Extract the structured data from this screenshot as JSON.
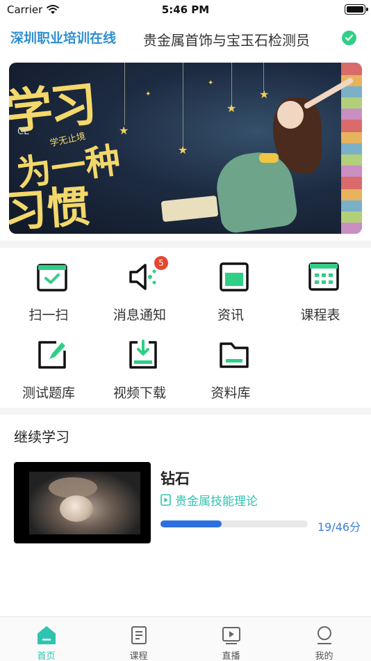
{
  "status_bar": {
    "carrier": "Carrier",
    "time": "5:46 PM"
  },
  "header": {
    "brand": "深圳职业培训在线",
    "course_title": "贵金属首饰与宝玉石检测员"
  },
  "banner": {
    "line1": "学习",
    "line2": "为一种",
    "line3": "习惯",
    "small": "学无止境",
    "ce": "CE"
  },
  "quick_grid": [
    {
      "label": "扫一扫",
      "icon": "calendar-check-icon"
    },
    {
      "label": "消息通知",
      "icon": "speaker-icon",
      "badge": "5"
    },
    {
      "label": "资讯",
      "icon": "news-icon"
    },
    {
      "label": "课程表",
      "icon": "schedule-icon"
    },
    {
      "label": "测试题库",
      "icon": "edit-icon"
    },
    {
      "label": "视频下载",
      "icon": "download-icon"
    },
    {
      "label": "资料库",
      "icon": "folder-icon"
    }
  ],
  "continue": {
    "title": "继续学习",
    "card": {
      "lesson": "钻石",
      "course": "贵金属技能理论",
      "progress_text": "19/46分",
      "progress_fraction": 0.413
    }
  },
  "tabbar": [
    {
      "label": "首页",
      "icon": "home-icon",
      "active": true
    },
    {
      "label": "课程",
      "icon": "book-icon",
      "active": false
    },
    {
      "label": "直播",
      "icon": "live-play-icon",
      "active": false
    },
    {
      "label": "我的",
      "icon": "profile-icon",
      "active": false
    }
  ],
  "colors": {
    "accent": "#2fc4b2",
    "icon_green": "#2fcf86",
    "progress": "#2d6fdc",
    "badge": "#e8452f",
    "brand": "#2f8fd0"
  }
}
